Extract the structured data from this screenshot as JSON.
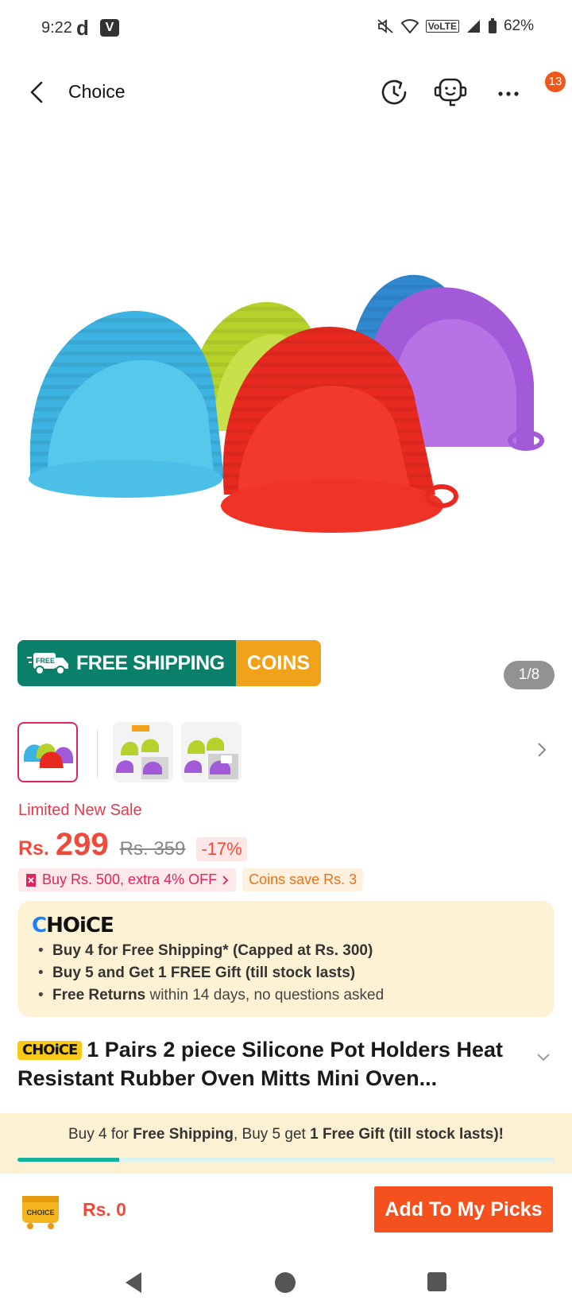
{
  "status_bar": {
    "time": "9:22",
    "app_icon_d": "d",
    "app_icon_v": "V",
    "network": "VoLTE",
    "battery": "62%"
  },
  "header": {
    "title": "Choice",
    "cart_badge": "13",
    "icons": [
      "back-icon",
      "history-icon",
      "support-agent-icon",
      "more-icon"
    ]
  },
  "gallery": {
    "counter": "1/8",
    "promo_left": "FREE SHIPPING",
    "promo_truck_text": "FREE",
    "promo_right": "COINS"
  },
  "price": {
    "sale_label": "Limited New Sale",
    "currency": "Rs.",
    "value": "299",
    "old_price": "Rs. 359",
    "discount": "-17%",
    "chip_offer": "Buy Rs. 500, extra 4% OFF",
    "chip_coins": "Coins save Rs. 3"
  },
  "choice_box": {
    "logo": "CHOiCE",
    "items": [
      {
        "bold": "Buy 4 for  Free Shipping* (Capped at Rs. 300)",
        "rest": ""
      },
      {
        "bold": "Buy 5 and Get 1 FREE Gift (till stock lasts)",
        "rest": ""
      },
      {
        "bold": "Free Returns",
        "rest": " within 14 days, no questions asked"
      }
    ]
  },
  "product": {
    "tag": "CHOiCE",
    "title": "1 Pairs 2 piece Silicone Pot Holders Heat Resistant Rubber Oven Mitts Mini Oven..."
  },
  "promo_strip": {
    "t1": "Buy 4 for ",
    "t2": "Free Shipping",
    "t3": ", Buy 5 get ",
    "t4": "1 Free Gift (till stock lasts)!",
    "progress": 0.19
  },
  "bottom_bar": {
    "cart_label": "CHOICE",
    "total": "Rs. 0",
    "add_button": "Add To My Picks"
  },
  "colors": {
    "accent": "#f4511e",
    "price": "#f04a3a",
    "choice_yellow": "#f9c91a",
    "teal": "#0a7f6a"
  }
}
